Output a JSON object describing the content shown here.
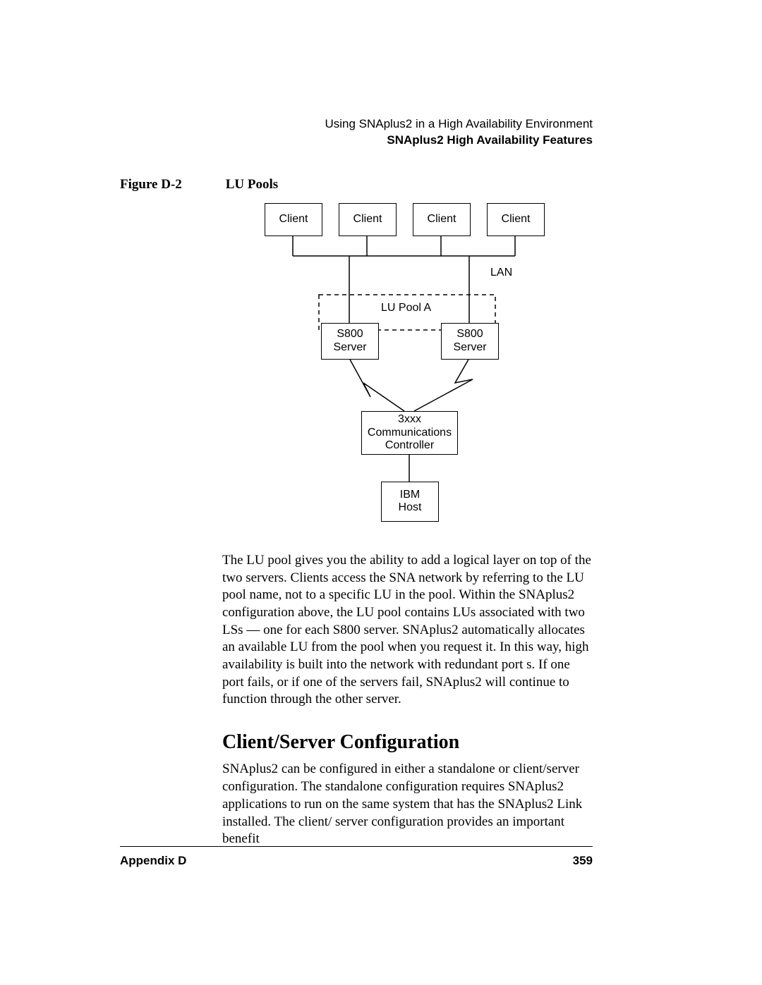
{
  "header": {
    "line1": "Using SNAplus2 in a High Availability Environment",
    "line2": "SNAplus2 High Availability Features"
  },
  "figure": {
    "label": "Figure D-2",
    "title": "LU Pools",
    "boxes": {
      "client1": "Client",
      "client2": "Client",
      "client3": "Client",
      "client4": "Client",
      "lan": "LAN",
      "pool": "LU Pool A",
      "server1": "S800\nServer",
      "server2": "S800\nServer",
      "comm": "3xxx\nCommunications\nController",
      "host": "IBM\nHost"
    }
  },
  "paragraphs": {
    "p1": "The LU pool gives you the ability to add a logical layer on top of the two servers. Clients access the SNA network by referring to the LU pool name, not to a specific LU in the pool. Within the SNAplus2 configuration above, the LU pool contains LUs associated with two LSs — one for each S800 server. SNAplus2 automatically allocates an available LU from the pool when you request it. In this way, high availability is built into the network with redundant port s. If one port fails, or if one of the servers fail, SNAplus2 will continue to function through the other server.",
    "heading": "Client/Server Configuration",
    "p2": "SNAplus2 can be configured in either a standalone or client/server configuration. The standalone configuration requires SNAplus2 applications to run on the same system that has the SNAplus2 Link installed. The client/ server configuration provides an important benefit"
  },
  "footer": {
    "appendix": "Appendix D",
    "page": "359"
  }
}
